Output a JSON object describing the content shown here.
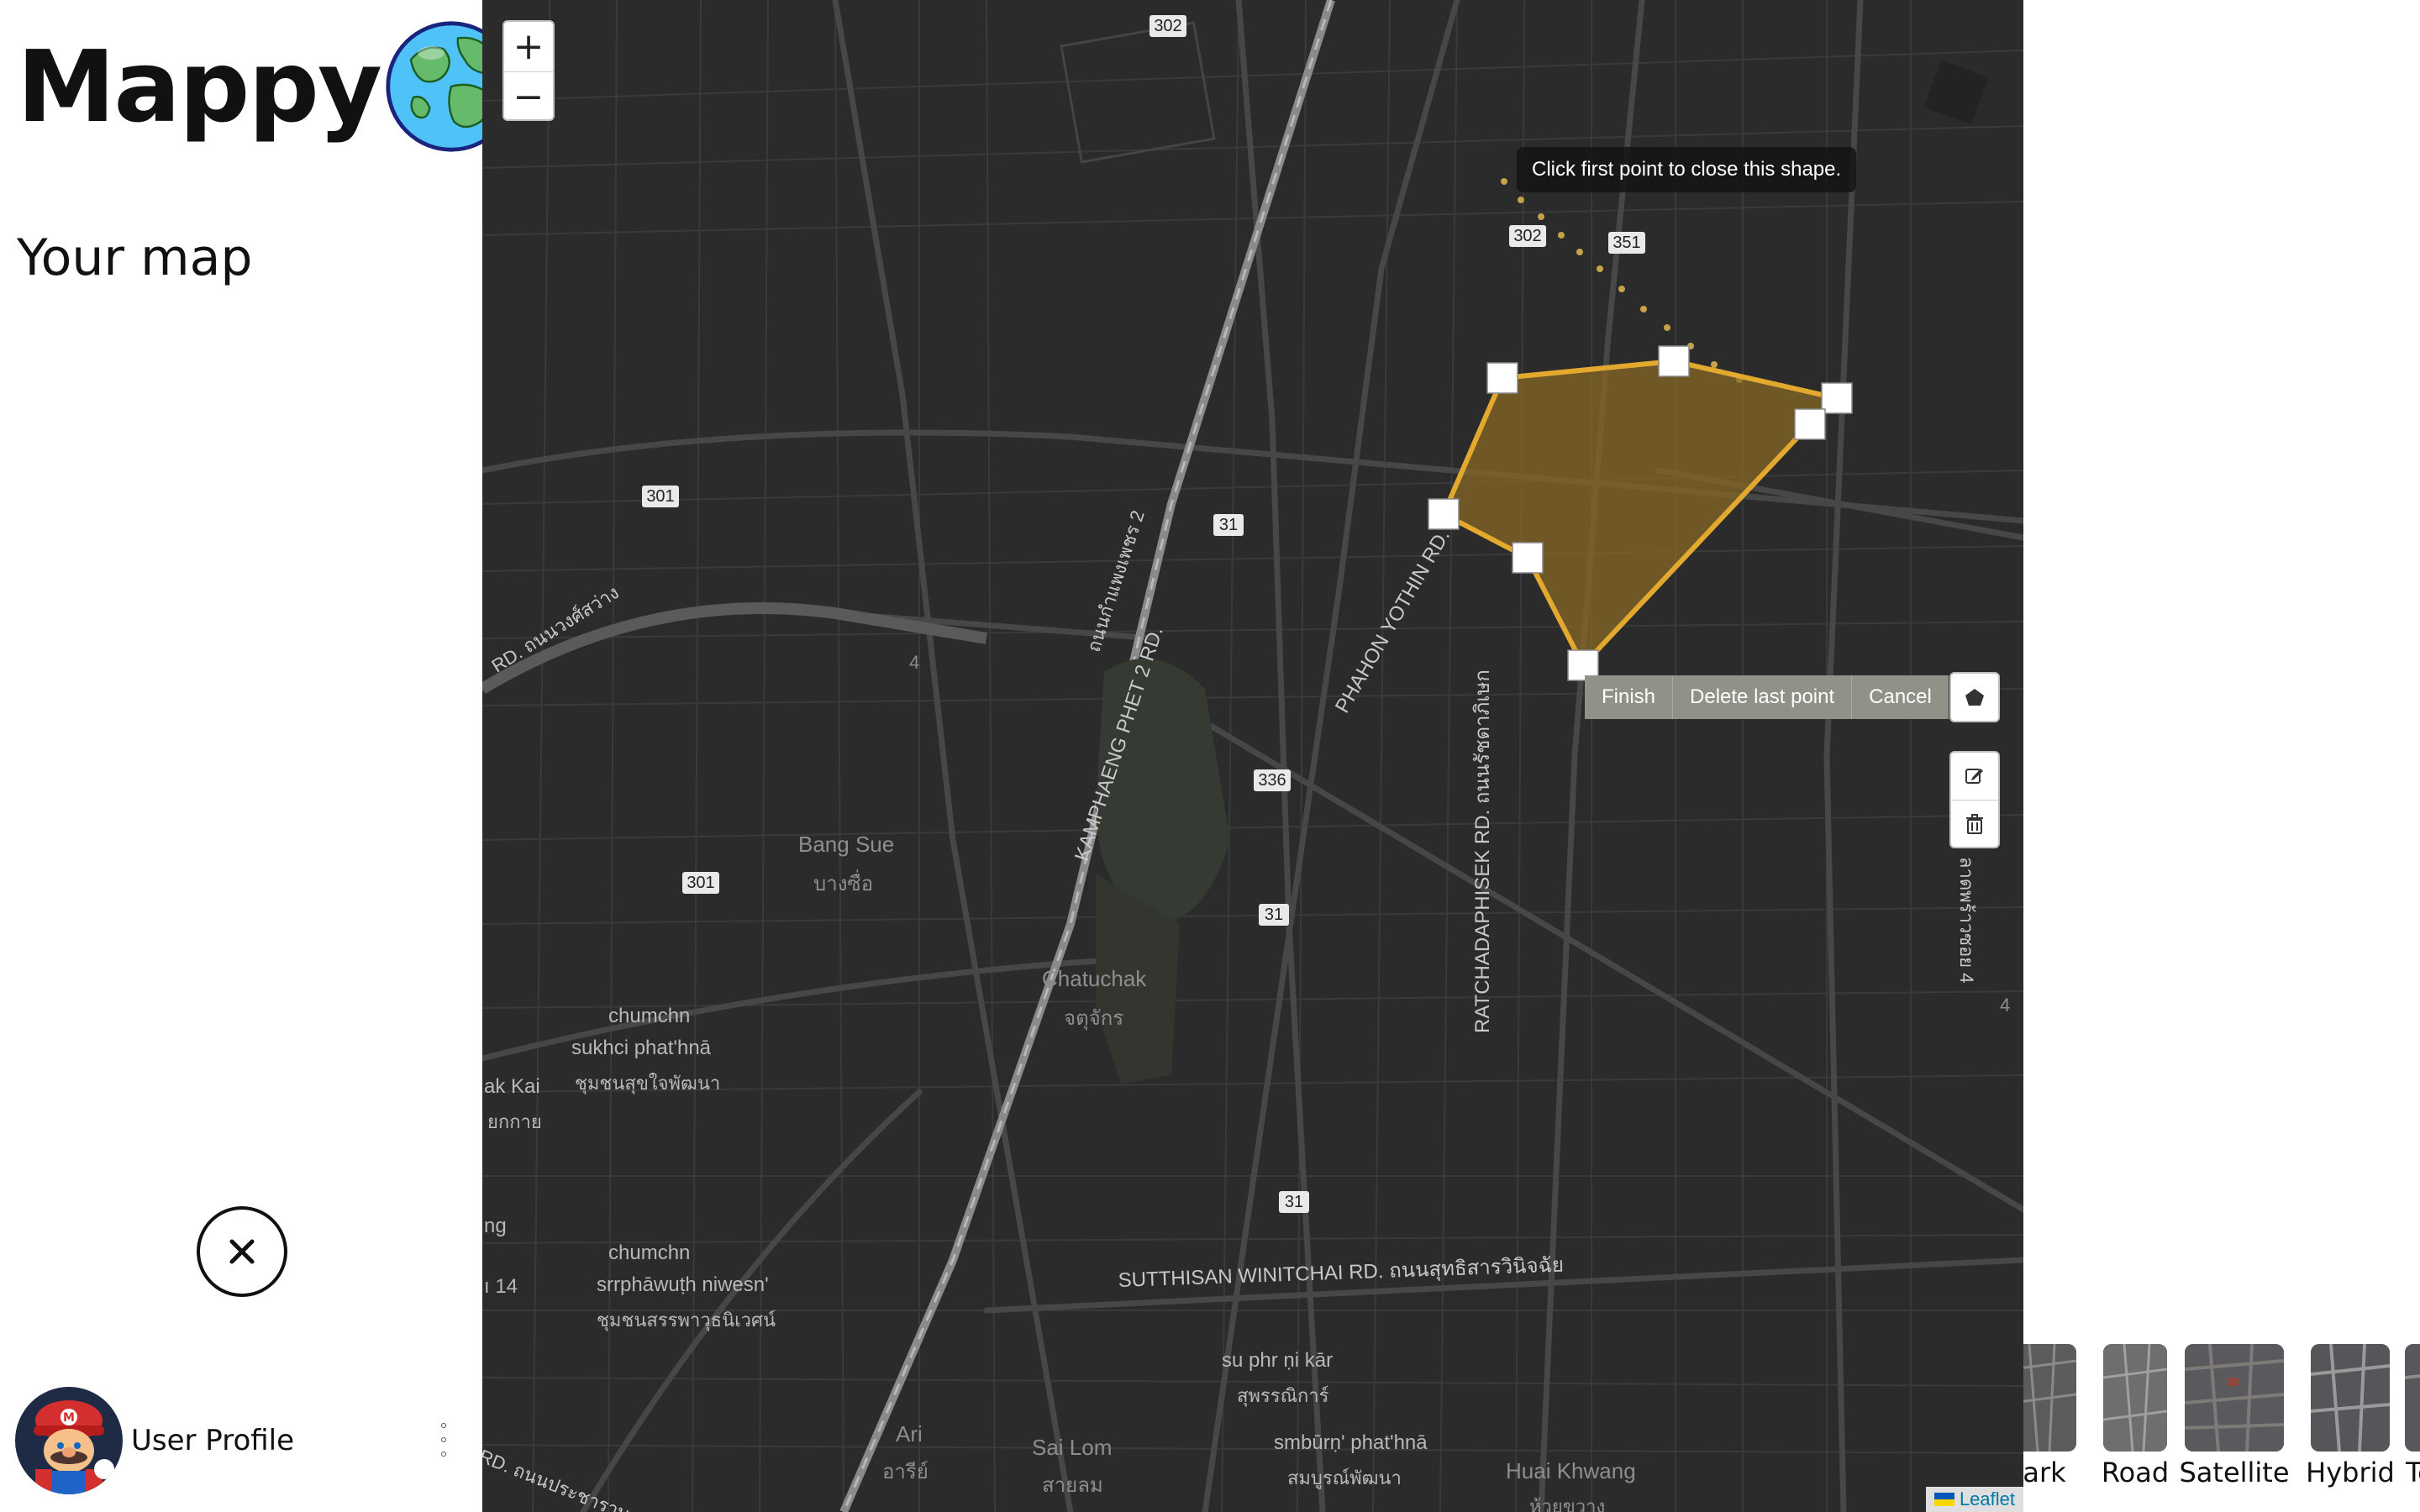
{
  "sidebar": {
    "brand": "Mappy",
    "subtitle": "Your map",
    "user_label": "User Profile"
  },
  "map": {
    "zoom_in": "+",
    "zoom_out": "−",
    "tooltip": "Click first point to close this shape.",
    "draw_actions": [
      "Finish",
      "Delete last point",
      "Cancel"
    ],
    "attribution": "Leaflet",
    "road_shields": [
      "302",
      "302",
      "351",
      "301",
      "301",
      "31",
      "31",
      "31",
      "336"
    ],
    "street_labels": {
      "kamphaeng": "KAMPHAENG PHET 2 RD.",
      "kamphaeng_thai": "ถนนกำแพงเพชร 2",
      "phahon": "PHAHON YOTHIN RD.",
      "ratchada": "RATCHADAPHISEK RD. ถนนรัชดาภิเษก",
      "sutthisan": "SUTTHISAN WINITCHAI RD. ถนนสุทธิสารวินิจฉัย",
      "left_top": "RD. ถนนวงศ์สว่าง",
      "left_bottom": "RD. ถนนประชาราษฎร์",
      "right_edge": "ลาดพร้าวซอย 4"
    },
    "place_labels": {
      "bang_sue": "Bang Sue",
      "bang_sue_thai": "บางซื่อ",
      "chatuchak": "Chatuchak",
      "chatuchak_thai": "จตุจักร",
      "chumchon1": "chumchn",
      "chumchon1_b": "sukhci phat'hnā",
      "chumchon1_c": "ชุมชนสุขใจพัฒนา",
      "chumchon2": "chumchn",
      "chumchon2_b": "srrphāwuṭh niwesn'",
      "chumchon2_c": "ชุมชนสรรพาวุธนิเวศน์",
      "sukhon": "su phr ṇi kār",
      "sukhon_thai": "สุพรรณิการ์",
      "sombun": "smbūrṇ' phat'hnā",
      "sombun_thai": "สมบูรณ์พัฒนา",
      "sai_lom": "Sai Lom",
      "sai_lom_thai": "สายลม",
      "ari": "Ari",
      "ari_thai": "อารีย์",
      "huai_khwang": "Huai Khwang",
      "huai_khwang_thai": "ห้วยขวาง",
      "ak_kai": "ak Kai",
      "ak_kai_thai": "ยกกาย",
      "ng": "ng",
      "num_14": "ı 14",
      "num_4": "4",
      "num_4b": "4"
    }
  },
  "layers": [
    "ark",
    "Road",
    "Satellite",
    "Hybrid",
    "Terrai"
  ],
  "colors": {
    "map_bg": "#2b2b2b",
    "shape_stroke": "#e3a92e",
    "shape_fill": "#8a6a24"
  }
}
